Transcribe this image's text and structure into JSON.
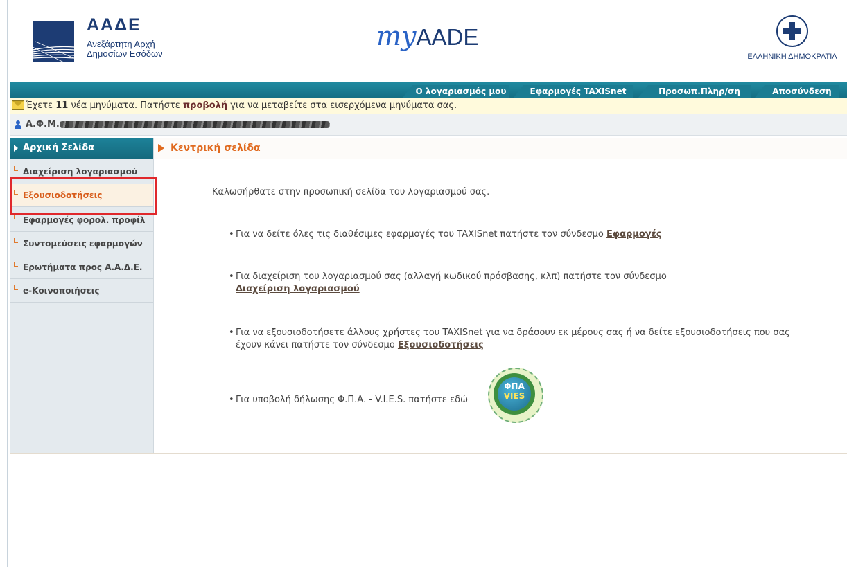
{
  "header": {
    "aade_title": "ΑΑΔΕ",
    "aade_sub1": "Ανεξάρτητη Αρχή",
    "aade_sub2": "Δημοσίων Εσόδων",
    "myaade_my": "my",
    "myaade_aade": "AADE",
    "emblem_text": "ΕΛΛΗΝΙΚΗ ΔΗΜΟΚΡΑΤΙΑ"
  },
  "topnav": {
    "tabs": [
      "Ο λογαριασμός μου",
      "Εφαρμογές TAXISnet",
      "Προσωπ.Πληρ/ση",
      "Αποσύνδεση"
    ]
  },
  "message": {
    "pre": "Έχετε ",
    "count": "11",
    "mid": " νέα μηνύματα. Πατήστε ",
    "link": "προβολή",
    "post": " για να μεταβείτε στα εισερχόμενα μηνύματα σας."
  },
  "afm": {
    "label": "Α.Φ.Μ.:"
  },
  "sidebar": {
    "home": "Αρχική Σελίδα",
    "items": [
      "Διαχείριση λογαριασμού",
      "Εξουσιοδοτήσεις",
      "Εφαρμογές φορολ. προφίλ",
      "Συντομεύσεις εφαρμογών",
      "Ερωτήματα προς Α.Α.Δ.Ε.",
      "e-Κοινοποιήσεις"
    ]
  },
  "main": {
    "title": "Κεντρική σελίδα",
    "welcome": "Καλωσήρθατε στην προσωπική σελίδα του λογαριασμού σας.",
    "b1_text": "Για να δείτε όλες τις διαθέσιμες εφαρμογές του TAXISnet πατήστε τον σύνδεσμο ",
    "b1_link": "Εφαρμογές",
    "b2_text": "Για διαχείριση του λογαριασμού σας (αλλαγή κωδικού πρόσβασης, κλπ) πατήστε τον σύνδεσμο",
    "b2_link": "Διαχείριση λογαριασμού",
    "b3_text": "Για να εξουσιοδοτήσετε άλλους χρήστες του TAXISnet για να δράσουν εκ μέρους σας ή να δείτε εξουσιοδοτήσεις που σας έχουν κάνει πατήστε τον σύνδεσμο ",
    "b3_link": "Εξουσιοδοτήσεις",
    "b4_text": "Για υποβολή δήλωσης Φ.Π.Α. - V.I.E.S. πατήστε εδώ",
    "vies_t1": "ΦΠΑ",
    "vies_t2": "VIES"
  }
}
